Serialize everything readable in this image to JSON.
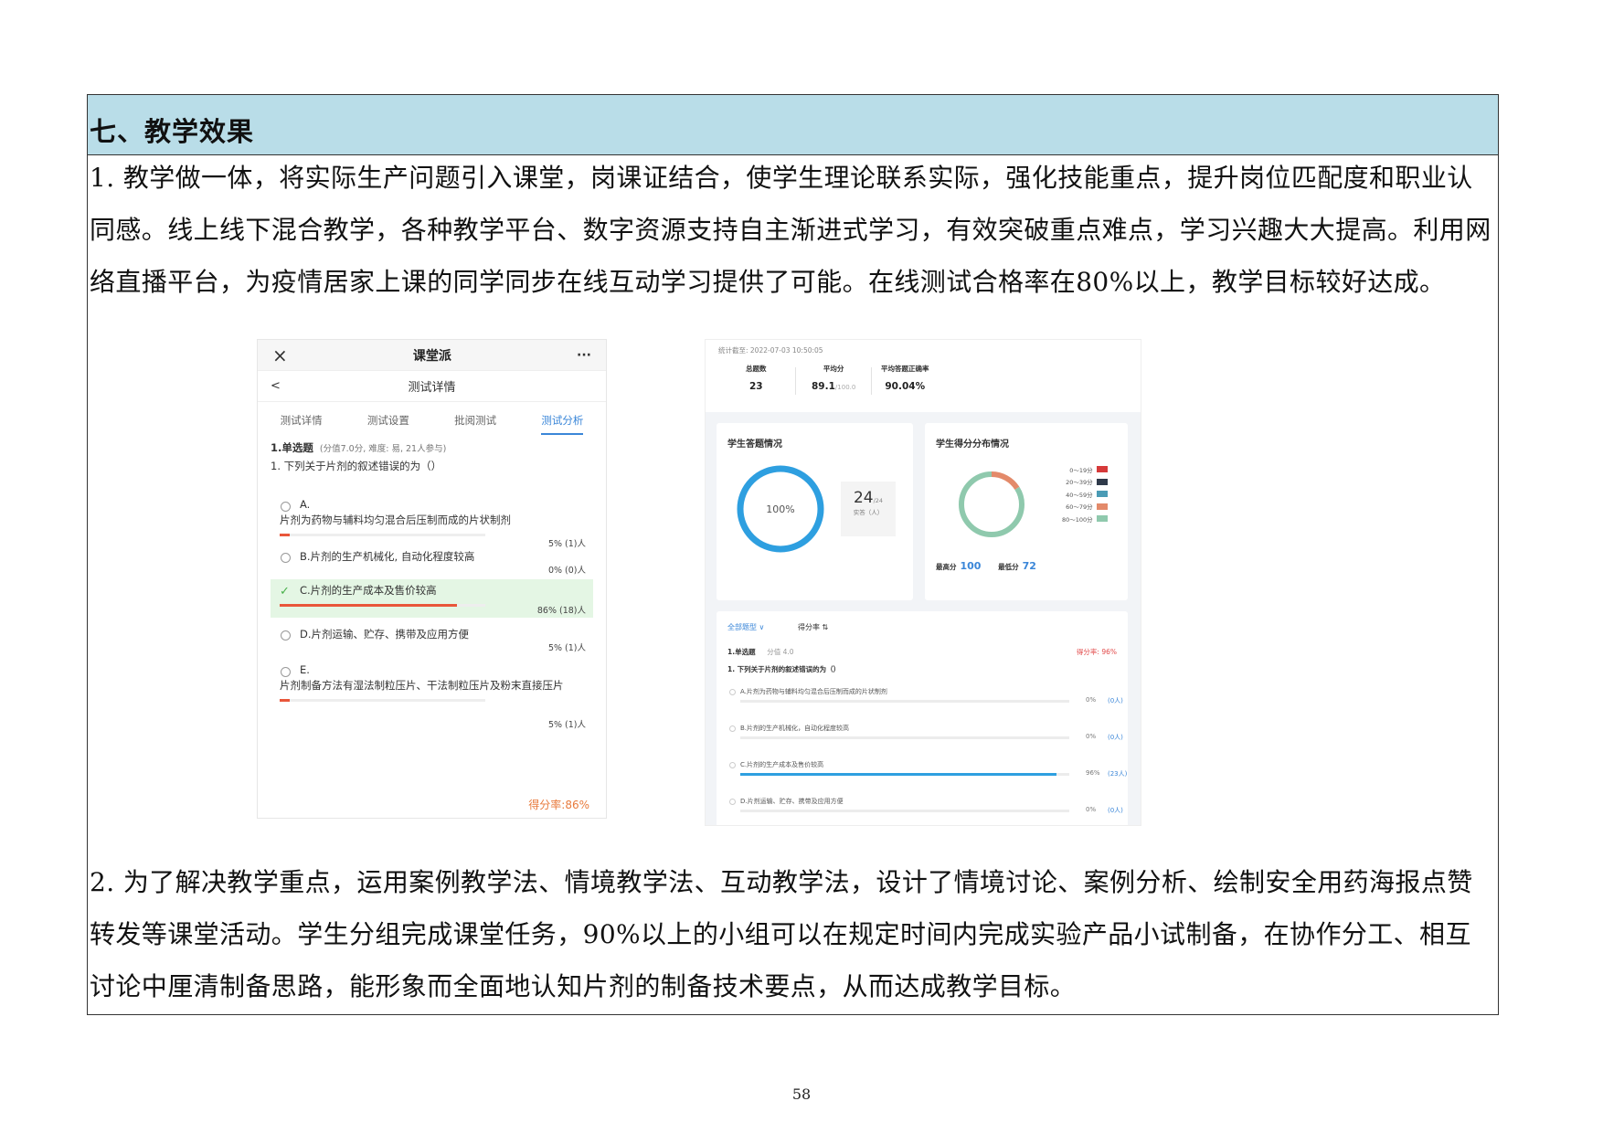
{
  "section": {
    "title": "七、教学效果"
  },
  "paragraphs": {
    "p1": "1. 教学做一体，将实际生产问题引入课堂，岗课证结合，使学生理论联系实际，强化技能重点，提升岗位匹配度和职业认同感。线上线下混合教学，各种教学平台、数字资源支持自主渐进式学习，有效突破重点难点，学习兴趣大大提高。利用网络直播平台，为疫情居家上课的同学同步在线互动学习提供了可能。在线测试合格率在80%以上，教学目标较好达成。",
    "p2": "2. 为了解决教学重点，运用案例教学法、情境教学法、互动教学法，设计了情境讨论、案例分析、绘制安全用药海报点赞转发等课堂活动。学生分组完成课堂任务，90%以上的小组可以在规定时间内完成实验产品小试制备，在协作分工、相互讨论中厘清制备思路，能形象而全面地认知片剂的制备技术要点，从而达成教学目标。"
  },
  "mobile": {
    "app_title": "课堂派",
    "close_icon": "×",
    "more_icon": "···",
    "back_icon": "<",
    "subtitle": "测试详情",
    "tabs": [
      "测试详情",
      "测试设置",
      "批阅测试",
      "测试分析"
    ],
    "question_type": "1.单选题",
    "question_meta": "(分值7.0分, 难度: 易, 21人参与)",
    "question": "1.  下列关于片剂的叙述错误的为（）",
    "options": [
      {
        "label": "A.",
        "text": "片剂为药物与辅料均匀混合后压制而成的片状制剂",
        "stat": "5%  (1)人",
        "pct": 5
      },
      {
        "label": "",
        "text": "B.片剂的生产机械化, 自动化程度较高",
        "stat": "0%  (0)人",
        "pct": 0
      },
      {
        "label": "",
        "text": "C.片剂的生产成本及售价较高",
        "stat": "86%  (18)人",
        "pct": 86
      },
      {
        "label": "",
        "text": "D.片剂运输、贮存、携带及应用方便",
        "stat": "5%  (1)人",
        "pct": 5
      },
      {
        "label": "E.",
        "text": "片剂制备方法有湿法制粒压片、干法制粒压片及粉末直接压片",
        "stat": "5%  (1)人",
        "pct": 5
      }
    ],
    "score_rate": "得分率:86%"
  },
  "dashboard": {
    "stamp": "统计截至: 2022-07-03 10:50:05",
    "stats": [
      {
        "label": "总题数",
        "value": "23",
        "sub": ""
      },
      {
        "label": "平均分",
        "value": "89.1",
        "sub": "/100.0"
      },
      {
        "label": "平均答题正确率",
        "value": "90.04%",
        "sub": ""
      }
    ],
    "answer_card": {
      "title": "学生答题情况",
      "ring_label": "100%",
      "ring_pct": 100,
      "count": "24",
      "count_sub": "/24",
      "count_caption": "实答（人）"
    },
    "dist_card": {
      "title": "学生得分分布情况",
      "legend": [
        {
          "label": "0～19分",
          "color": "#d63a3a"
        },
        {
          "label": "20～39分",
          "color": "#2f3a4a"
        },
        {
          "label": "40～59分",
          "color": "#4a9bb5"
        },
        {
          "label": "60～79分",
          "color": "#e38a6a"
        },
        {
          "label": "80～100分",
          "color": "#8fc9ad"
        }
      ],
      "segments": [
        {
          "pct": 16,
          "color": "#e38a6a"
        },
        {
          "pct": 84,
          "color": "#8fc9ad"
        }
      ],
      "max_label": "最高分",
      "max": "100",
      "min_label": "最低分",
      "min": "72"
    },
    "filter": {
      "all": "全部题型 ∨",
      "score": "得分率 ⇅"
    },
    "question_type": "1.单选题",
    "question_meta": "分值 4.0",
    "question_rate": "得分率: 96%",
    "question": "1.  下列关于片剂的叙述错误的为（）",
    "options": [
      {
        "text": "A.片剂为药物与辅料均匀混合后压制而成的片状制剂",
        "pct_label": "0%",
        "num": "(0人)",
        "pct": 0
      },
      {
        "text": "B.片剂的生产机械化，自动化程度较高",
        "pct_label": "0%",
        "num": "(0人)",
        "pct": 0
      },
      {
        "text": "C.片剂的生产成本及售价较高",
        "pct_label": "96%",
        "num": "(23人)",
        "pct": 96
      },
      {
        "text": "D.片剂运输、贮存、携带及应用方便",
        "pct_label": "0%",
        "num": "(0人)",
        "pct": 0
      }
    ]
  },
  "page_number": "58"
}
